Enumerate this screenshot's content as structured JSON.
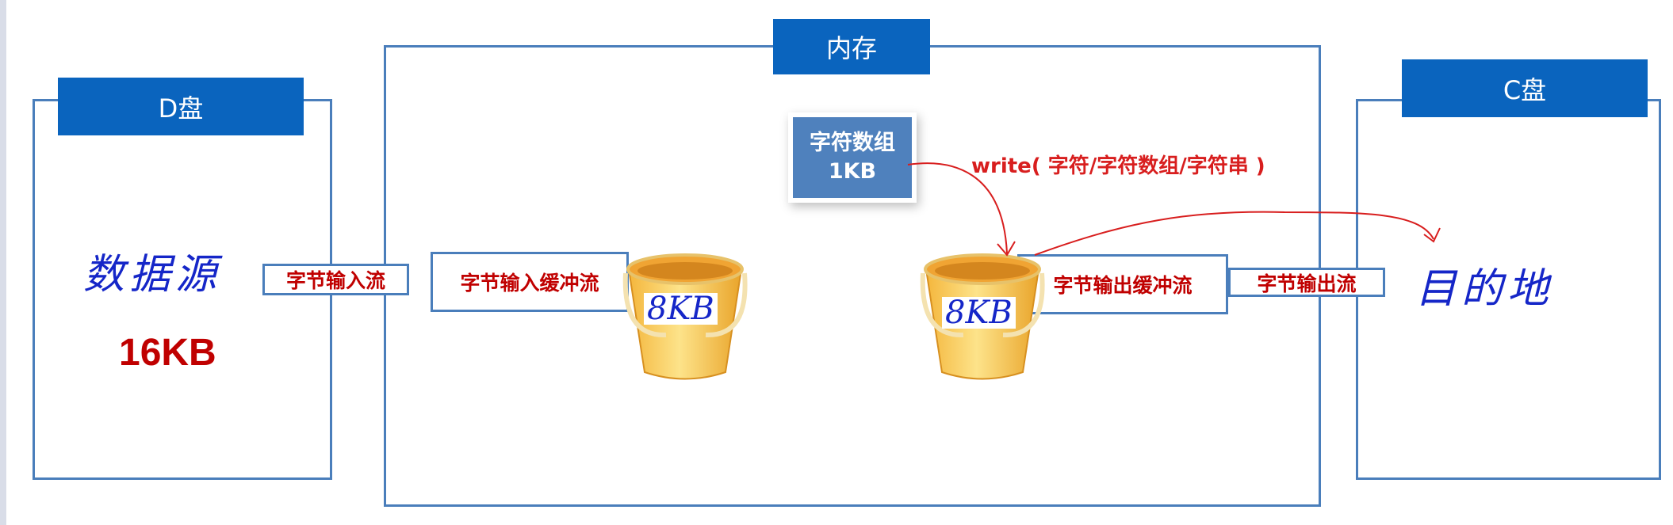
{
  "memory": {
    "title": "内存"
  },
  "d_drive": {
    "title": "D盘",
    "source_label": "数据源",
    "size": "16KB"
  },
  "c_drive": {
    "title": "C盘",
    "dest_label": "目的地"
  },
  "char_array": {
    "line1": "字符数组",
    "line2": "1KB"
  },
  "write_call": "write( 字符/字符数组/字符串 )",
  "streams": {
    "byte_input": "字节输入流",
    "byte_input_buffered": "字节输入缓冲流",
    "byte_output_buffered": "字节输出缓冲流",
    "byte_output": "字节输出流"
  },
  "buckets": {
    "left_label": "8KB",
    "right_label": "8KB"
  },
  "colors": {
    "header": "#0a64be",
    "border": "#4a7ebb",
    "arrow": "#d81e1e",
    "label_red": "#c00000",
    "handwriting_blue": "#1526c8"
  }
}
